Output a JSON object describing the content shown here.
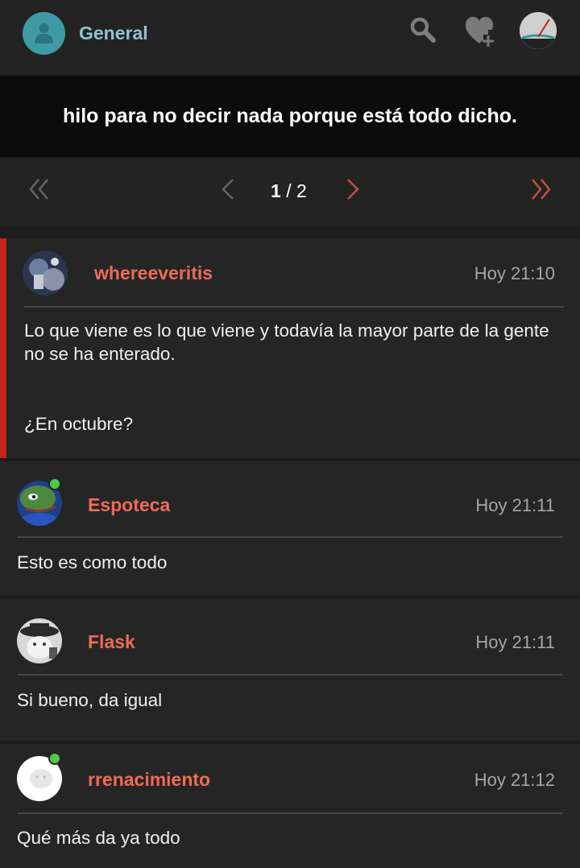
{
  "header": {
    "forum_name": "General",
    "icons": [
      "user-icon",
      "search-icon",
      "heart-plus-icon",
      "profile-avatar"
    ]
  },
  "thread": {
    "title": "hilo para no decir nada porque está todo dicho."
  },
  "pager": {
    "current": "1",
    "separator": "/",
    "total": "2"
  },
  "posts": [
    {
      "author": "whereeveritis",
      "time": "Hoy 21:10",
      "online": false,
      "paragraphs": [
        "Lo que viene es lo que viene y todavía la mayor parte de la gente no se ha enterado.",
        "¿En octubre?"
      ]
    },
    {
      "author": "Espoteca",
      "time": "Hoy 21:11",
      "online": true,
      "paragraphs": [
        "Esto es como todo"
      ]
    },
    {
      "author": "Flask",
      "time": "Hoy 21:11",
      "online": false,
      "paragraphs": [
        "Si bueno, da igual"
      ]
    },
    {
      "author": "rrenacimiento",
      "time": "Hoy 21:12",
      "online": true,
      "paragraphs": [
        "Qué más da ya todo"
      ]
    }
  ],
  "colors": {
    "accent": "#ee6b58",
    "highlight_bar": "#c4221b",
    "forum_teal": "#3f9aa6",
    "online": "#4ec94a"
  }
}
